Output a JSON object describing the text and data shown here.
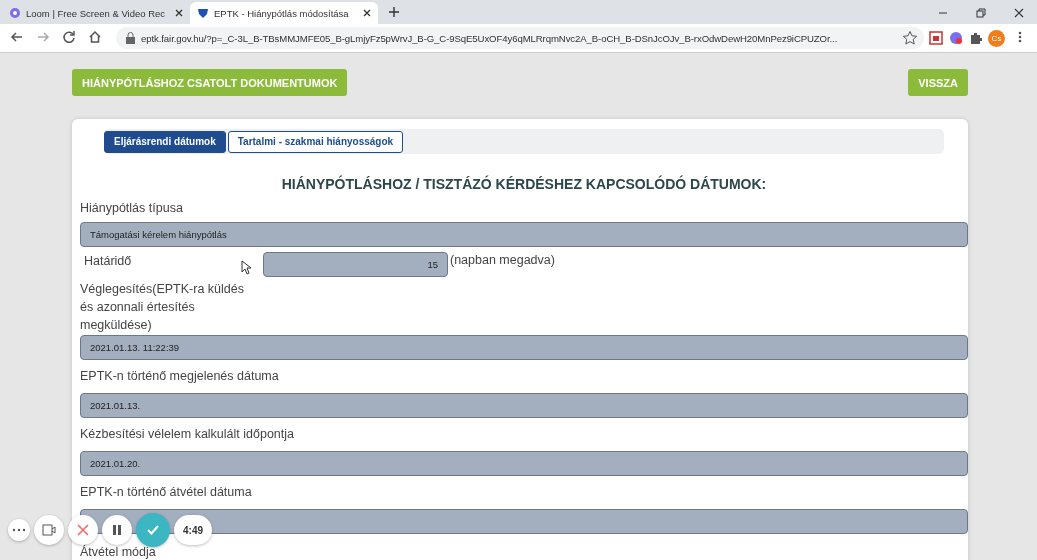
{
  "browser": {
    "tabs": [
      {
        "title": "Loom | Free Screen & Video Rec",
        "selected": false
      },
      {
        "title": "EPTK - Hiánypótlás módosítása",
        "selected": true
      }
    ],
    "url": "eptk.fair.gov.hu/?p=_C-3L_B-TBsMMJMFE05_B-gLmjyFz5pWrvJ_B-G_C-9SqE5UxOF4y6qMLRrqmNvc2A_B-oCH_B-DSnJcOJv_B-rxOdwDewH20MnPez9iCPUZOr...",
    "profile": "Cs"
  },
  "page": {
    "documents_button": "HIÁNYPÓTLÁSHOZ CSATOLT DOKUMENTUMOK",
    "back_button": "VISSZA",
    "tabs": [
      {
        "label": "Eljárásrendi dátumok",
        "selected": true
      },
      {
        "label": "Tartalmi - szakmai hiányosságok",
        "selected": false
      }
    ],
    "heading": "HIÁNYPÓTLÁSHOZ / TISZTÁZÓ KÉRDÉSHEZ KAPCSOLÓDÓ DÁTUMOK:",
    "fields": [
      {
        "kind": "full",
        "label": "Hiánypótlás típusa",
        "value": "Támogatási kérelem hiánypótlás"
      },
      {
        "kind": "inline",
        "label": "Határidő",
        "value": "15",
        "suffix": "(napban megadva)"
      },
      {
        "kind": "narrow",
        "label": "Véglegesítés(EPTK-ra küldés és azonnali értesítés megküldése)",
        "value": "2021.01.13. 11:22:39"
      },
      {
        "kind": "full",
        "label": "EPTK-n történő megjelenés dátuma",
        "value": "2021.01.13."
      },
      {
        "kind": "full",
        "label": "Kézbesítési vélelem kalkulált időpontja",
        "value": "2021.01.20."
      },
      {
        "kind": "full",
        "label": "EPTK-n történő átvétel dátuma"
      },
      {
        "kind": "label",
        "label": "Átvétel módja"
      }
    ]
  },
  "recorder": {
    "timer": "4:49"
  }
}
